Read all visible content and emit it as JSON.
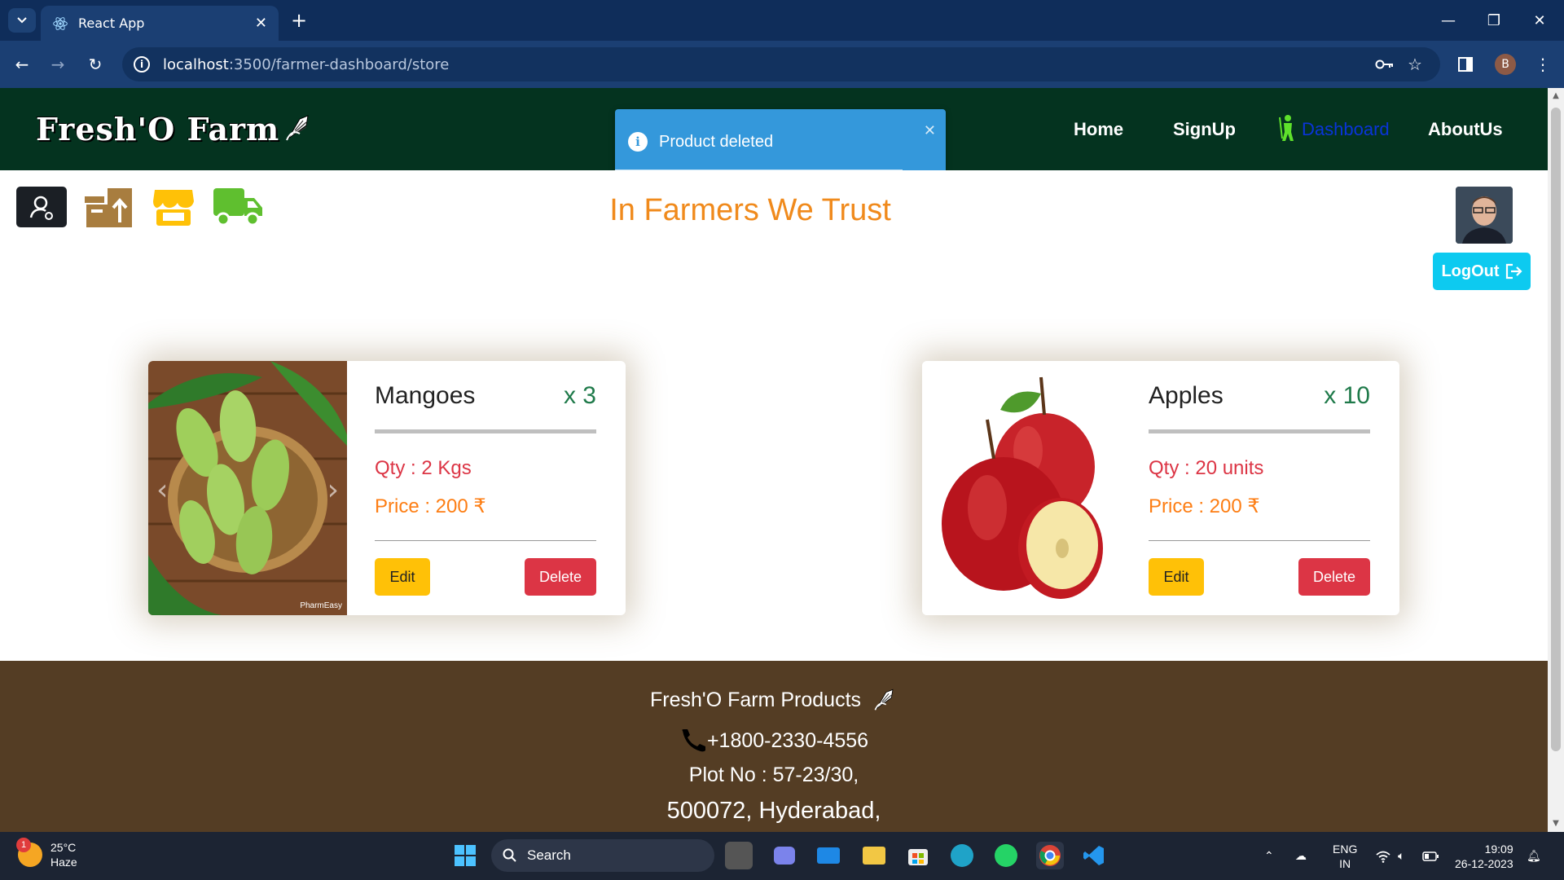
{
  "browser": {
    "tab_title": "React App",
    "url_host": "localhost",
    "url_path": ":3500/farmer-dashboard/store",
    "profile_initial": "B"
  },
  "navbar": {
    "logo_text": "Fresh'O Farm",
    "links": [
      "Home",
      "SignUp",
      "Dashboard",
      "AboutUs"
    ]
  },
  "toast": {
    "message": "Product deleted",
    "progress": 0.87
  },
  "page": {
    "tagline": "In Farmers We Trust",
    "logout_label": "LogOut"
  },
  "products": [
    {
      "name": "Mangoes",
      "count": "x 3",
      "qty": "Qty : 2 Kgs",
      "price": "Price : 200 ₹",
      "edit_label": "Edit",
      "delete_label": "Delete",
      "image_watermark": "PharmEasy"
    },
    {
      "name": "Apples",
      "count": "x 10",
      "qty": "Qty : 20 units",
      "price": "Price : 200 ₹",
      "edit_label": "Edit",
      "delete_label": "Delete"
    }
  ],
  "footer": {
    "title": "Fresh'O Farm Products",
    "phone": "+1800-2330-4556",
    "address_line1": "Plot No : 57-23/30,",
    "address_line2": "500072, Hyderabad,"
  },
  "taskbar": {
    "weather_temp": "25°C",
    "weather_desc": "Haze",
    "weather_badge": "1",
    "search_label": "Search",
    "lang_line1": "ENG",
    "lang_line2": "IN",
    "time": "19:09",
    "date": "26-12-2023"
  },
  "colors": {
    "navbar_bg": "#04331f",
    "footer_bg": "#543d24",
    "tagline": "#f08a1c",
    "toast_bg": "#3498db",
    "edit_btn": "#ffc107",
    "delete_btn": "#dc3545",
    "logout_btn": "#0dcaf0"
  }
}
